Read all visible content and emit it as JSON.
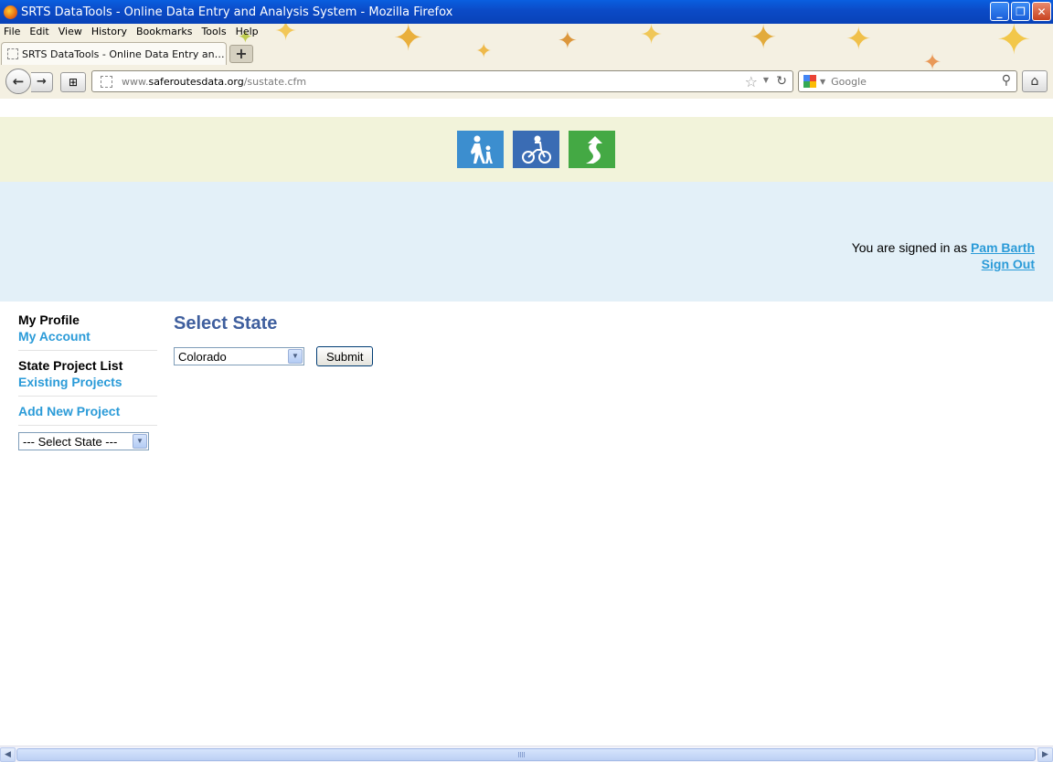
{
  "window": {
    "title": "SRTS DataTools - Online Data Entry and Analysis System - Mozilla Firefox",
    "buttons": [
      "minimize",
      "restore",
      "close"
    ]
  },
  "menubar": {
    "items": [
      "File",
      "Edit",
      "View",
      "History",
      "Bookmarks",
      "Tools",
      "Help"
    ]
  },
  "tabs": [
    {
      "title": "SRTS DataTools - Online Data Entry and Ana..."
    }
  ],
  "navbar": {
    "url_prefix": "www.",
    "url_domain": "saferoutesdata.org",
    "url_path": "/sustate.cfm",
    "search_placeholder": "Google"
  },
  "header": {
    "logos": [
      "walking-logo-icon",
      "bicycle-logo-icon",
      "route-logo-icon"
    ],
    "signed_in_prefix": "You are signed in as ",
    "user_name": "Pam Barth",
    "sign_out": "Sign Out"
  },
  "sidebar": {
    "profile_heading": "My Profile",
    "my_account": "My Account",
    "project_list_heading": "State Project List",
    "existing_projects": "Existing Projects",
    "add_new_project": "Add New Project",
    "state_select_value": "--- Select State ---"
  },
  "main": {
    "title": "Select State",
    "state_select_value": "Colorado",
    "submit_label": "Submit"
  },
  "colors": {
    "title_bar": "#0b4ac6",
    "logo_band": "#f2f3da",
    "user_band": "#e3f0f8",
    "link": "#2b9bd8",
    "heading": "#3f5f9e",
    "walk_logo": "#3c8ecf",
    "bike_logo": "#3a6cb4",
    "route_logo": "#44a944"
  }
}
